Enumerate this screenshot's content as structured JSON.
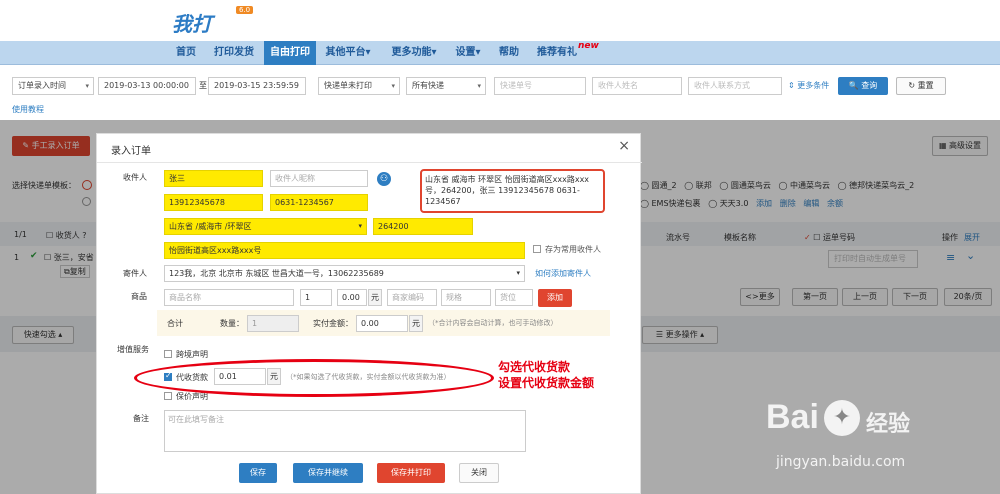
{
  "brand": {
    "logo": "我打",
    "version": "6.0"
  },
  "nav": {
    "items": [
      "首页",
      "打印发货",
      "自由打印",
      "其他平台▾",
      "更多功能▾",
      "设置▾",
      "帮助",
      "推荐有礼"
    ],
    "new_badge": "new"
  },
  "filter": {
    "time_type": "订单录入时间",
    "start": "2019-03-13 00:00:00",
    "to": "至",
    "end": "2019-03-15 23:59:59",
    "print_status": "快递单未打印",
    "express": "所有快递",
    "tracking_ph": "快递单号",
    "receiver_ph": "收件人姓名",
    "contact_ph": "收件人联系方式",
    "more_cond": "更多条件",
    "search": "查询",
    "reset": "重置",
    "tutorial": "使用教程"
  },
  "bg": {
    "manual_entry": "手工录入订单",
    "advanced": "高级设置",
    "template_label": "选择快递单模板：",
    "templates": [
      "圆通_2",
      "联邦",
      "圆通菜鸟云",
      "中通菜鸟云",
      "德邦快递菜鸟云_2"
    ],
    "ems": "EMS快递包裹",
    "tt": "天天3.0",
    "add": "添加",
    "del": "删除",
    "edit": "编辑",
    "balance": "余额",
    "page_count": "1/1",
    "col_receiver": "收货人 ?",
    "col_serial": "流水号",
    "col_template": "模板名称",
    "col_waybill": "运单号码",
    "col_op": "操作",
    "expand": "展开",
    "row_no": "1",
    "row_name": "张三，安省",
    "copy": "复制",
    "waybill_ph": "打印时自动生成单号",
    "more_page": "<>更多",
    "first": "第一页",
    "prev": "上一页",
    "next": "下一页",
    "per_page": "20条/页",
    "quick_select": "快速勾选 ▴",
    "more_ops": "更多操作 ▴"
  },
  "modal": {
    "title": "录入订单",
    "close": "×",
    "receiver_label": "收件人",
    "name": "张三",
    "nick_ph": "收件人昵称",
    "phone": "13912345678",
    "tel": "0631-1234567",
    "region": "山东省 /威海市 /环翠区",
    "zip": "264200",
    "address": "怡园街道高区xxx路xxx号",
    "save_common": "存为常用收件人",
    "paste_text": "山东省 威海市 环翠区 怡园街道高区xxx路xxx号，264200，张三 13912345678 0631-1234567",
    "sender_label": "寄件人",
    "sender": "123我，北京 北京市 东城区 世昌大道一号，13062235689",
    "add_sender": "如何添加寄件人",
    "goods_label": "商品",
    "goods_name_ph": "商品名称",
    "qty": "1",
    "price": "0.00",
    "unit": "元",
    "code_ph": "商家编码",
    "spec_ph": "规格",
    "pos_ph": "货位",
    "add": "添加",
    "total": "合计",
    "qty_label": "数量：",
    "qty_total": "1",
    "paid_label": "实付金额：",
    "paid": "0.00",
    "paid_unit": "元",
    "paid_note": "（*合计内容会自动计算，也可手动修改）",
    "vas_label": "增值服务",
    "cross": "跨境声明",
    "cod": "代收货款",
    "cod_amount": "0.01",
    "cod_unit": "元",
    "cod_note": "（*如果勾选了代收货款，实付金额以代收货款为准）",
    "insure": "保价声明",
    "remark_label": "备注",
    "remark_ph": "可在此填写备注",
    "save": "保存",
    "save_continue": "保存并继续",
    "save_print": "保存并打印",
    "close_btn": "关闭"
  },
  "annotation": {
    "line1": "勾选代收货款",
    "line2": "设置代收货款金额"
  },
  "watermark": {
    "brand": "Bai",
    "brand2": "经验",
    "url": "jingyan.baidu.com"
  }
}
